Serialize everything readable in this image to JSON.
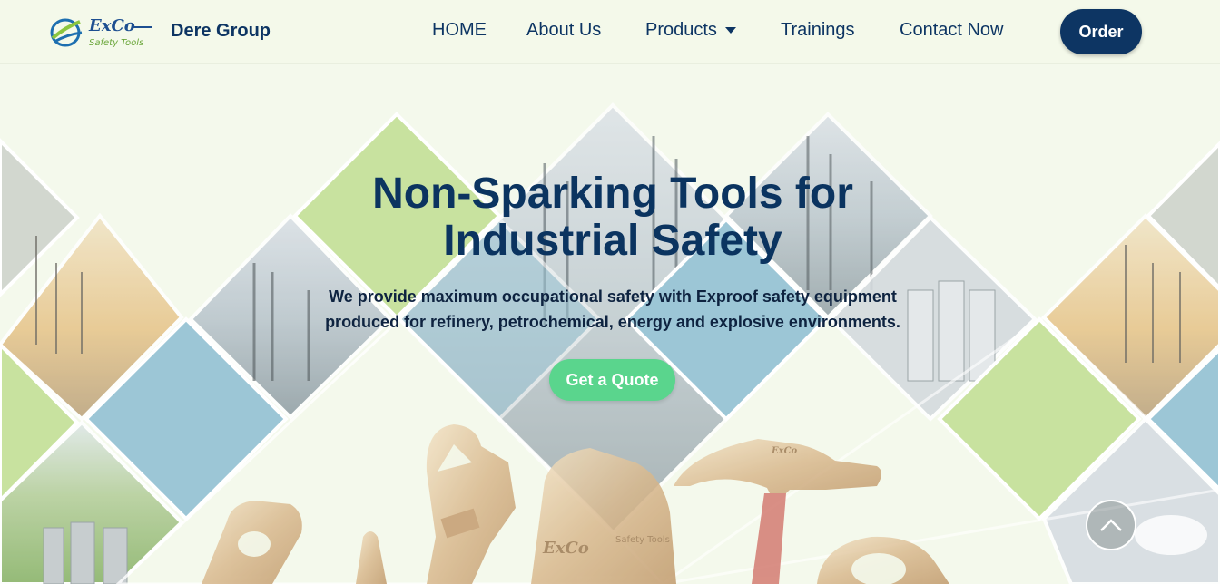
{
  "brand": {
    "logo_text": "ExCo",
    "logo_tagline": "Safety Tools",
    "name": "Dere Group"
  },
  "nav": {
    "items": [
      {
        "label": "HOME"
      },
      {
        "label": "About Us"
      },
      {
        "label": "Products",
        "has_dropdown": true
      },
      {
        "label": "Trainings"
      },
      {
        "label": "Contact Now"
      }
    ],
    "order_label": "Order"
  },
  "hero": {
    "title_line1": "Non-Sparking Tools for",
    "title_line2": "Industrial Safety",
    "subtitle_line1": "We provide maximum occupational safety with Exproof safety equipment",
    "subtitle_line2": "produced for refinery, petrochemical, energy and explosive environments.",
    "cta_label": "Get a Quote",
    "tool_engraving": "ExCo",
    "tool_engraving_tagline": "Safety Tools"
  },
  "colors": {
    "navy": "#0d3563",
    "accent_green": "#5ad58d",
    "lime_tile": "#c8e29f",
    "blue_tile": "#9cc6d6",
    "background": "#f4f9ec"
  },
  "icons": {
    "scroll_top": "chevron-up-icon",
    "dropdown": "caret-down-icon"
  }
}
